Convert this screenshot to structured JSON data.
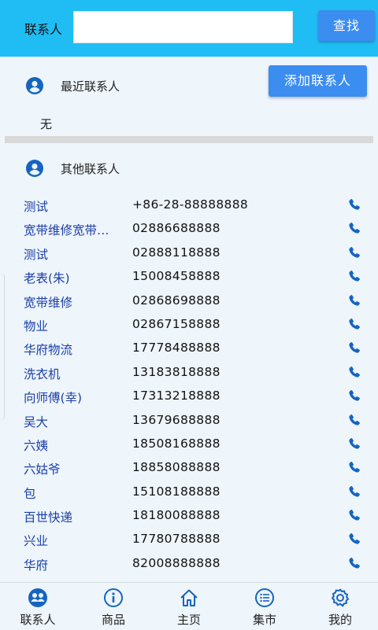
{
  "header": {
    "contact_label": "联系人",
    "search_value": "",
    "search_button": "查找"
  },
  "add_contact_button": "添加联系人",
  "recent": {
    "title": "最近联系人",
    "empty_text": "无"
  },
  "others": {
    "title": "其他联系人",
    "contacts": [
      {
        "name": "测试",
        "phone": "+86-28-88888888"
      },
      {
        "name": "宽带维修宽带维修",
        "phone": "02886688888"
      },
      {
        "name": "测试",
        "phone": "02888118888"
      },
      {
        "name": "老表(朱)",
        "phone": "15008458888"
      },
      {
        "name": "宽带维修",
        "phone": "02868698888"
      },
      {
        "name": "物业",
        "phone": "02867158888"
      },
      {
        "name": "华府物流",
        "phone": "17778488888"
      },
      {
        "name": "洗衣机",
        "phone": "13183818888"
      },
      {
        "name": "向师傅(幸)",
        "phone": "17313218888"
      },
      {
        "name": "吴大",
        "phone": "13679688888"
      },
      {
        "name": "六姨",
        "phone": "18508168888"
      },
      {
        "name": "六姑爷",
        "phone": "18858088888"
      },
      {
        "name": "包",
        "phone": "15108188888"
      },
      {
        "name": "百世快递",
        "phone": "18180088888"
      },
      {
        "name": "兴业",
        "phone": "17780788888"
      },
      {
        "name": "华府",
        "phone": "82008888888"
      }
    ]
  },
  "nav": [
    {
      "label": "联系人",
      "icon": "contacts-icon"
    },
    {
      "label": "商品",
      "icon": "info-icon"
    },
    {
      "label": "主页",
      "icon": "home-icon"
    },
    {
      "label": "集市",
      "icon": "list-icon"
    },
    {
      "label": "我的",
      "icon": "gear-icon"
    }
  ],
  "colors": {
    "header_bg": "#1fbdf3",
    "button": "#3b8df0",
    "accent": "#1565c0",
    "page_bg": "#eef5fb",
    "name_text": "#1a3fa8"
  }
}
